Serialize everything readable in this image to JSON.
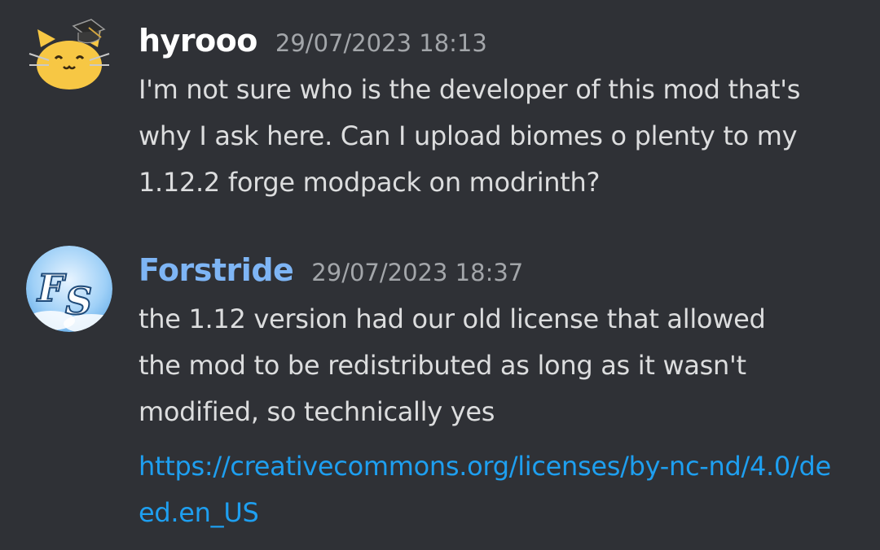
{
  "messages": [
    {
      "author": "hyrooo",
      "timestamp": "29/07/2023 18:13",
      "text": "I'm not sure who is the developer of this mod that's\nwhy I ask here. Can I upload biomes o plenty to my\n1.12.2 forge modpack on modrinth?",
      "avatar": "cat-with-graduation-cap-avatar"
    },
    {
      "author": "Forstride",
      "timestamp": "29/07/2023 18:37",
      "text": "the 1.12 version had our old license that allowed\nthe mod to be redistributed as long as it wasn't\nmodified, so technically yes",
      "link": "https://creativecommons.org/licenses/by-nc-nd/4.0/deed.en_US",
      "avatar": "fs-monogram-avatar"
    }
  ],
  "colors": {
    "background": "#2f3136",
    "text": "#dcddde",
    "timestamp": "#a3a6aa",
    "username_hyrooo": "#ffffff",
    "username_forstride": "#7eb5f5",
    "link": "#1e9ff0"
  }
}
